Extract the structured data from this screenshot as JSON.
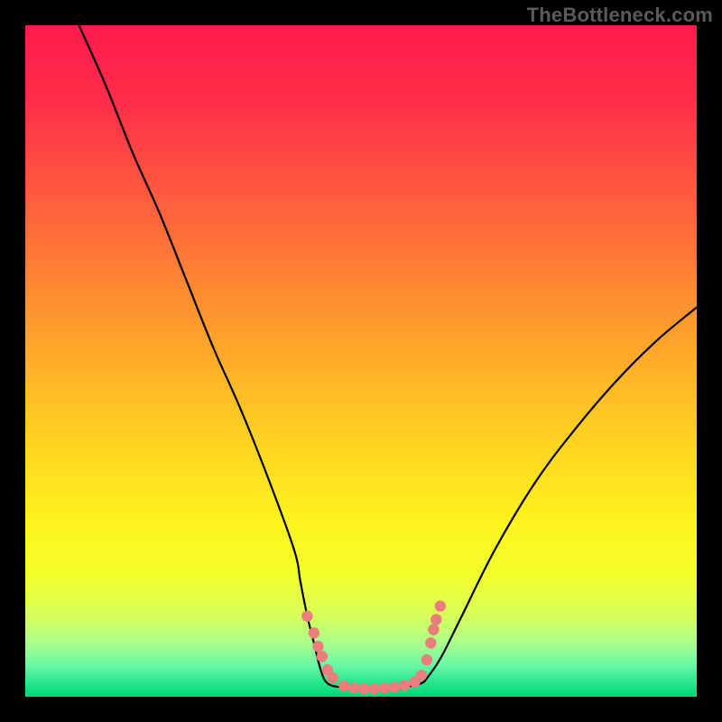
{
  "watermark": "TheBottleneck.com",
  "colors": {
    "frame": "#000000",
    "gradient_stops": [
      {
        "offset": 0.0,
        "color": "#ff1a4d"
      },
      {
        "offset": 0.12,
        "color": "#ff2f49"
      },
      {
        "offset": 0.3,
        "color": "#ff6a3a"
      },
      {
        "offset": 0.48,
        "color": "#ffa62a"
      },
      {
        "offset": 0.62,
        "color": "#ffd322"
      },
      {
        "offset": 0.74,
        "color": "#fff31e"
      },
      {
        "offset": 0.82,
        "color": "#f3ff2b"
      },
      {
        "offset": 0.88,
        "color": "#d7ff5a"
      },
      {
        "offset": 0.92,
        "color": "#aaff8c"
      },
      {
        "offset": 0.955,
        "color": "#66f7a7"
      },
      {
        "offset": 0.975,
        "color": "#2fe98f"
      },
      {
        "offset": 1.0,
        "color": "#00d976"
      }
    ],
    "curve": "#000000",
    "markers_fill": "#eb7d7d",
    "markers_stroke": "#d25b5b"
  },
  "chart_data": {
    "type": "line",
    "title": "",
    "xlabel": "",
    "ylabel": "",
    "xlim": [
      0,
      100
    ],
    "ylim": [
      0,
      100
    ],
    "grid": false,
    "note": "Values are estimated from pixel positions; x is normalized 0-100 across plot width, y is percentage height from bottom (higher = worse / red).",
    "series": [
      {
        "name": "left-branch",
        "x": [
          8,
          12,
          16,
          20,
          24,
          28,
          32,
          36,
          40,
          41,
          42,
          43,
          44,
          45
        ],
        "y": [
          100,
          91,
          81,
          72,
          62,
          52,
          43,
          33,
          22,
          17,
          12,
          8,
          4,
          2
        ]
      },
      {
        "name": "valley-floor",
        "x": [
          45,
          47,
          49,
          51,
          53,
          55,
          57,
          59
        ],
        "y": [
          2,
          1.4,
          1.2,
          1.1,
          1.1,
          1.2,
          1.5,
          2
        ]
      },
      {
        "name": "right-branch",
        "x": [
          59,
          60,
          62,
          65,
          70,
          76,
          82,
          88,
          94,
          100
        ],
        "y": [
          2,
          3,
          6,
          12,
          22,
          32,
          40,
          47,
          53,
          58
        ]
      }
    ],
    "markers": {
      "name": "highlight-dots",
      "points": [
        {
          "x": 42.0,
          "y": 12.0
        },
        {
          "x": 43.0,
          "y": 9.5
        },
        {
          "x": 43.6,
          "y": 7.5
        },
        {
          "x": 44.2,
          "y": 6.0
        },
        {
          "x": 45.0,
          "y": 4.0
        },
        {
          "x": 45.8,
          "y": 2.8
        },
        {
          "x": 47.5,
          "y": 1.6
        },
        {
          "x": 49.0,
          "y": 1.3
        },
        {
          "x": 50.5,
          "y": 1.2
        },
        {
          "x": 52.0,
          "y": 1.2
        },
        {
          "x": 53.5,
          "y": 1.3
        },
        {
          "x": 55.0,
          "y": 1.4
        },
        {
          "x": 56.5,
          "y": 1.7
        },
        {
          "x": 58.0,
          "y": 2.2
        },
        {
          "x": 59.0,
          "y": 3.2
        },
        {
          "x": 59.8,
          "y": 5.5
        },
        {
          "x": 60.4,
          "y": 8.0
        },
        {
          "x": 60.8,
          "y": 10.0
        },
        {
          "x": 61.2,
          "y": 11.5
        },
        {
          "x": 61.8,
          "y": 13.5
        }
      ]
    }
  }
}
